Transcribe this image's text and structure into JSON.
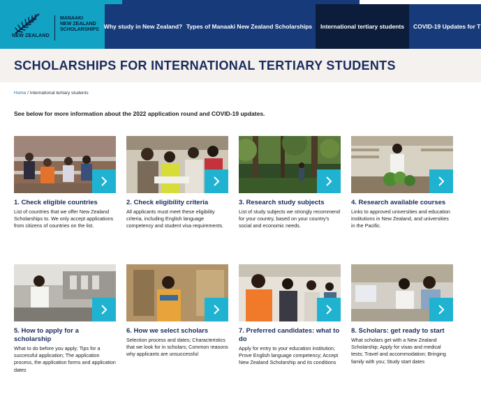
{
  "header": {
    "logo": {
      "country_text": "NEW ZEALAND",
      "brand_lines": [
        "MANAAKI",
        "NEW ZEALAND",
        "SCHOLARSHIPS"
      ]
    },
    "nav": [
      {
        "label": "Why study in New Zealand?",
        "active": false
      },
      {
        "label": "Types of Manaaki New Zealand Scholarships",
        "active": false
      },
      {
        "label": "International tertiary students",
        "active": true
      },
      {
        "label": "COVID-19 Updates for T",
        "active": false
      }
    ]
  },
  "page_title": "SCHOLARSHIPS FOR INTERNATIONAL TERTIARY STUDENTS",
  "breadcrumb": {
    "home": "Home",
    "separator": "/",
    "current": "International tertiary students"
  },
  "intro": "See below for more information about the 2022 application round and COVID-19 updates.",
  "cards": [
    {
      "title": "1. Check eligible countries",
      "description": "List of countries that we offer New Zealand Scholarships to. We only accept applications from citizens of countries on the list."
    },
    {
      "title": "2. Check eligibility criteria",
      "description": "All applicants must meet these eligibility criteria, including English language competency and student visa requirements."
    },
    {
      "title": "3. Research study subjects",
      "description": "List of study subjects we strongly recommend for your country, based on your country's social and economic needs."
    },
    {
      "title": "4. Research available courses",
      "description": "Links to approved universities and education institutions in New Zealand, and universities in the Pacific."
    },
    {
      "title": "5. How to apply for a scholarship",
      "description": "What to do before you apply; Tips for a successful application; The application process, the application forms and application dates"
    },
    {
      "title": "6. How we select scholars",
      "description": "Selection process and dates; Characteristics that we look for in scholars; Common reasons why applicants are unsuccessful"
    },
    {
      "title": "7. Preferred candidates: what to do",
      "description": "Apply for entry to your education institution; Prove English language competency; Accept New Zealand Scholarship and its conditions"
    },
    {
      "title": "8. Scholars: get ready to start",
      "description": "What scholars get with a New Zealand Scholarship; Apply for visas and medical tests; Travel and accommodation; Bringing family with you; Study start dates"
    }
  ],
  "colors": {
    "navy": "#163a7a",
    "dark_navy": "#0b1d3a",
    "teal": "#12a2c4",
    "arrow_teal": "#1fb3d1",
    "title_band": "#f4f1ee",
    "heading": "#1b2c5c"
  },
  "icons": {
    "logo": "silver-fern-icon",
    "card_arrow": "chevron-right-icon"
  }
}
